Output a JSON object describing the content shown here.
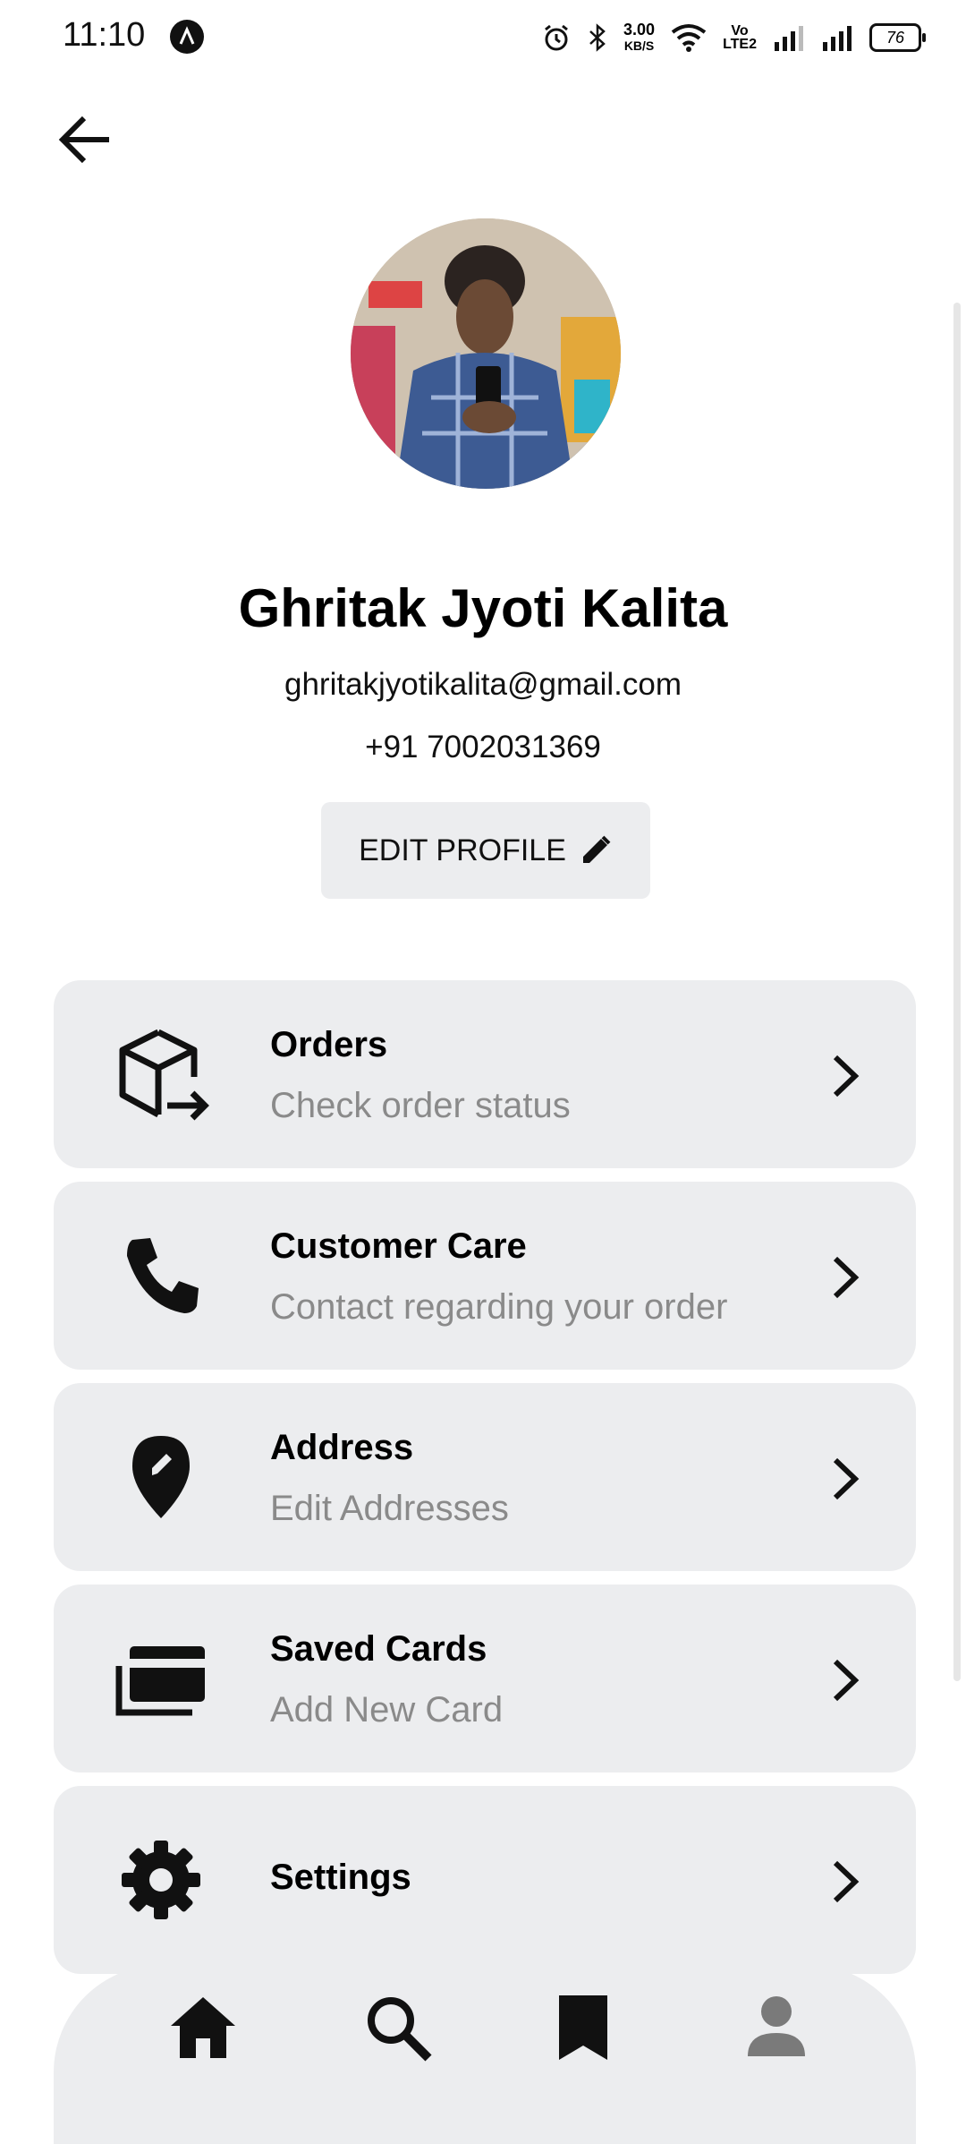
{
  "status_bar": {
    "time": "11:10",
    "net_speed_value": "3.00",
    "net_speed_unit": "KB/S",
    "volte_top": "Vo",
    "volte_bottom": "LTE2",
    "battery": "76"
  },
  "profile": {
    "name": "Ghritak Jyoti Kalita",
    "email": "ghritakjyotikalita@gmail.com",
    "phone": "+91 7002031369",
    "edit_label": "EDIT PROFILE"
  },
  "menu": [
    {
      "title": "Orders",
      "subtitle": "Check order status",
      "icon": "package-export-icon"
    },
    {
      "title": "Customer Care",
      "subtitle": "Contact regarding your order",
      "icon": "phone-icon"
    },
    {
      "title": "Address",
      "subtitle": "Edit Addresses",
      "icon": "location-pin-icon"
    },
    {
      "title": "Saved Cards",
      "subtitle": "Add New Card",
      "icon": "cards-icon"
    },
    {
      "title": "Settings",
      "subtitle": "",
      "icon": "gear-icon"
    }
  ],
  "bottom_nav": [
    {
      "icon": "home-icon",
      "active": true
    },
    {
      "icon": "search-icon",
      "active": false
    },
    {
      "icon": "bookmark-icon",
      "active": false
    },
    {
      "icon": "person-icon",
      "active": true
    }
  ],
  "colors": {
    "card_bg": "#ecedef",
    "subtitle": "#8a8a8a",
    "nav_active": "#111111",
    "nav_profile": "#7a7a7a"
  }
}
